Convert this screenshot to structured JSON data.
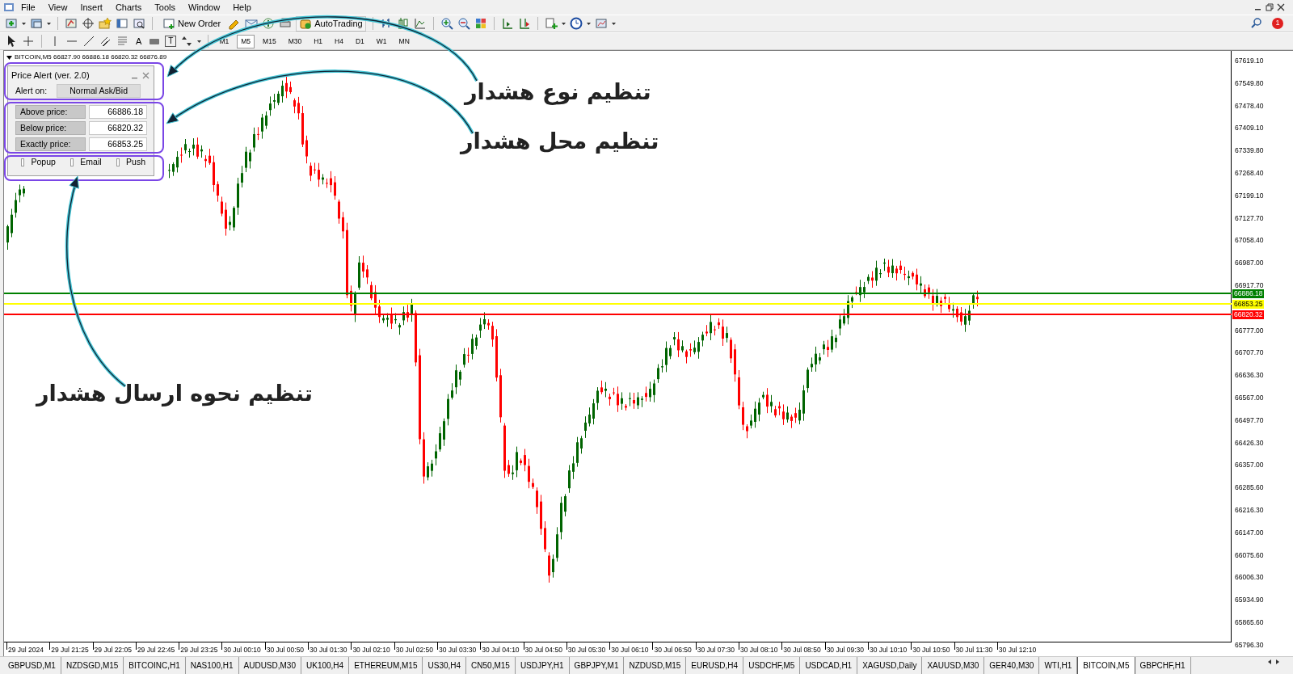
{
  "menu": [
    "File",
    "View",
    "Insert",
    "Charts",
    "Tools",
    "Window",
    "Help"
  ],
  "toolbar": {
    "new_order": "New Order",
    "auto_trading": "AutoTrading",
    "notifications": "1"
  },
  "drawing_tools": {
    "text_tool": "A",
    "text_label_tool": "T"
  },
  "timeframes": [
    {
      "label": "M1",
      "selected": false
    },
    {
      "label": "M5",
      "selected": true
    },
    {
      "label": "M15",
      "selected": false
    },
    {
      "label": "M30",
      "selected": false
    },
    {
      "label": "H1",
      "selected": false
    },
    {
      "label": "H4",
      "selected": false
    },
    {
      "label": "D1",
      "selected": false
    },
    {
      "label": "W1",
      "selected": false
    },
    {
      "label": "MN",
      "selected": false
    }
  ],
  "chart": {
    "header": "BITCOIN,M5  66827.90 66886.18 66820.32 66876.89",
    "price_axis": [
      "67619.10",
      "67549.80",
      "67478.40",
      "67409.10",
      "67339.80",
      "67268.40",
      "67199.10",
      "67127.70",
      "67058.40",
      "66987.00",
      "66917.70",
      "66777.00",
      "66707.70",
      "66636.30",
      "66567.00",
      "66497.70",
      "66426.30",
      "66357.00",
      "66285.60",
      "66216.30",
      "66147.00",
      "66075.60",
      "66006.30",
      "65934.90",
      "65865.60",
      "65796.30"
    ],
    "time_axis": [
      "29 Jul 2024",
      "29 Jul 21:25",
      "29 Jul 22:05",
      "29 Jul 22:45",
      "29 Jul 23:25",
      "30 Jul 00:10",
      "30 Jul 00:50",
      "30 Jul 01:30",
      "30 Jul 02:10",
      "30 Jul 02:50",
      "30 Jul 03:30",
      "30 Jul 04:10",
      "30 Jul 04:50",
      "30 Jul 05:30",
      "30 Jul 06:10",
      "30 Jul 06:50",
      "30 Jul 07:30",
      "30 Jul 08:10",
      "30 Jul 08:50",
      "30 Jul 09:30",
      "30 Jul 10:10",
      "30 Jul 10:50",
      "30 Jul 11:30",
      "30 Jul 12:10"
    ],
    "price_lines": [
      {
        "label": "66886.18",
        "color": "#008000"
      },
      {
        "label": "66853.25",
        "color": "#ffff00"
      },
      {
        "label": "66820.32",
        "color": "#ff0000"
      }
    ]
  },
  "panel": {
    "title": "Price Alert (ver. 2.0)",
    "alert_on_label": "Alert on:",
    "alert_on_value": "Normal Ask/Bid",
    "fields": [
      {
        "label": "Above price:",
        "value": "66886.18"
      },
      {
        "label": "Below price:",
        "value": "66820.32"
      },
      {
        "label": "Exactly price:",
        "value": "66853.25"
      }
    ],
    "checkboxes": [
      {
        "label": "Popup",
        "checked": false
      },
      {
        "label": "Email",
        "checked": false
      },
      {
        "label": "Push",
        "checked": false
      }
    ]
  },
  "annotations": [
    {
      "text": "تنظیم نوع هشدار"
    },
    {
      "text": "تنظیم محل هشدار"
    },
    {
      "text": "تنظیم نحوه ارسال هشدار"
    }
  ],
  "tabs": [
    {
      "label": "GBPUSD,M1",
      "selected": false
    },
    {
      "label": "NZDSGD,M15",
      "selected": false
    },
    {
      "label": "BITCOINC,H1",
      "selected": false
    },
    {
      "label": "NAS100,H1",
      "selected": false
    },
    {
      "label": "AUDUSD,M30",
      "selected": false
    },
    {
      "label": "UK100,H4",
      "selected": false
    },
    {
      "label": "ETHEREUM,M15",
      "selected": false
    },
    {
      "label": "US30,H4",
      "selected": false
    },
    {
      "label": "CN50,M15",
      "selected": false
    },
    {
      "label": "USDJPY,H1",
      "selected": false
    },
    {
      "label": "GBPJPY,M1",
      "selected": false
    },
    {
      "label": "NZDUSD,M15",
      "selected": false
    },
    {
      "label": "EURUSD,H4",
      "selected": false
    },
    {
      "label": "USDCHF,M5",
      "selected": false
    },
    {
      "label": "USDCAD,H1",
      "selected": false
    },
    {
      "label": "XAGUSD,Daily",
      "selected": false
    },
    {
      "label": "XAUUSD,M30",
      "selected": false
    },
    {
      "label": "GER40,M30",
      "selected": false
    },
    {
      "label": "WTI,H1",
      "selected": false
    },
    {
      "label": "BITCOIN,M5",
      "selected": true
    },
    {
      "label": "GBPCHF,H1",
      "selected": false
    }
  ]
}
